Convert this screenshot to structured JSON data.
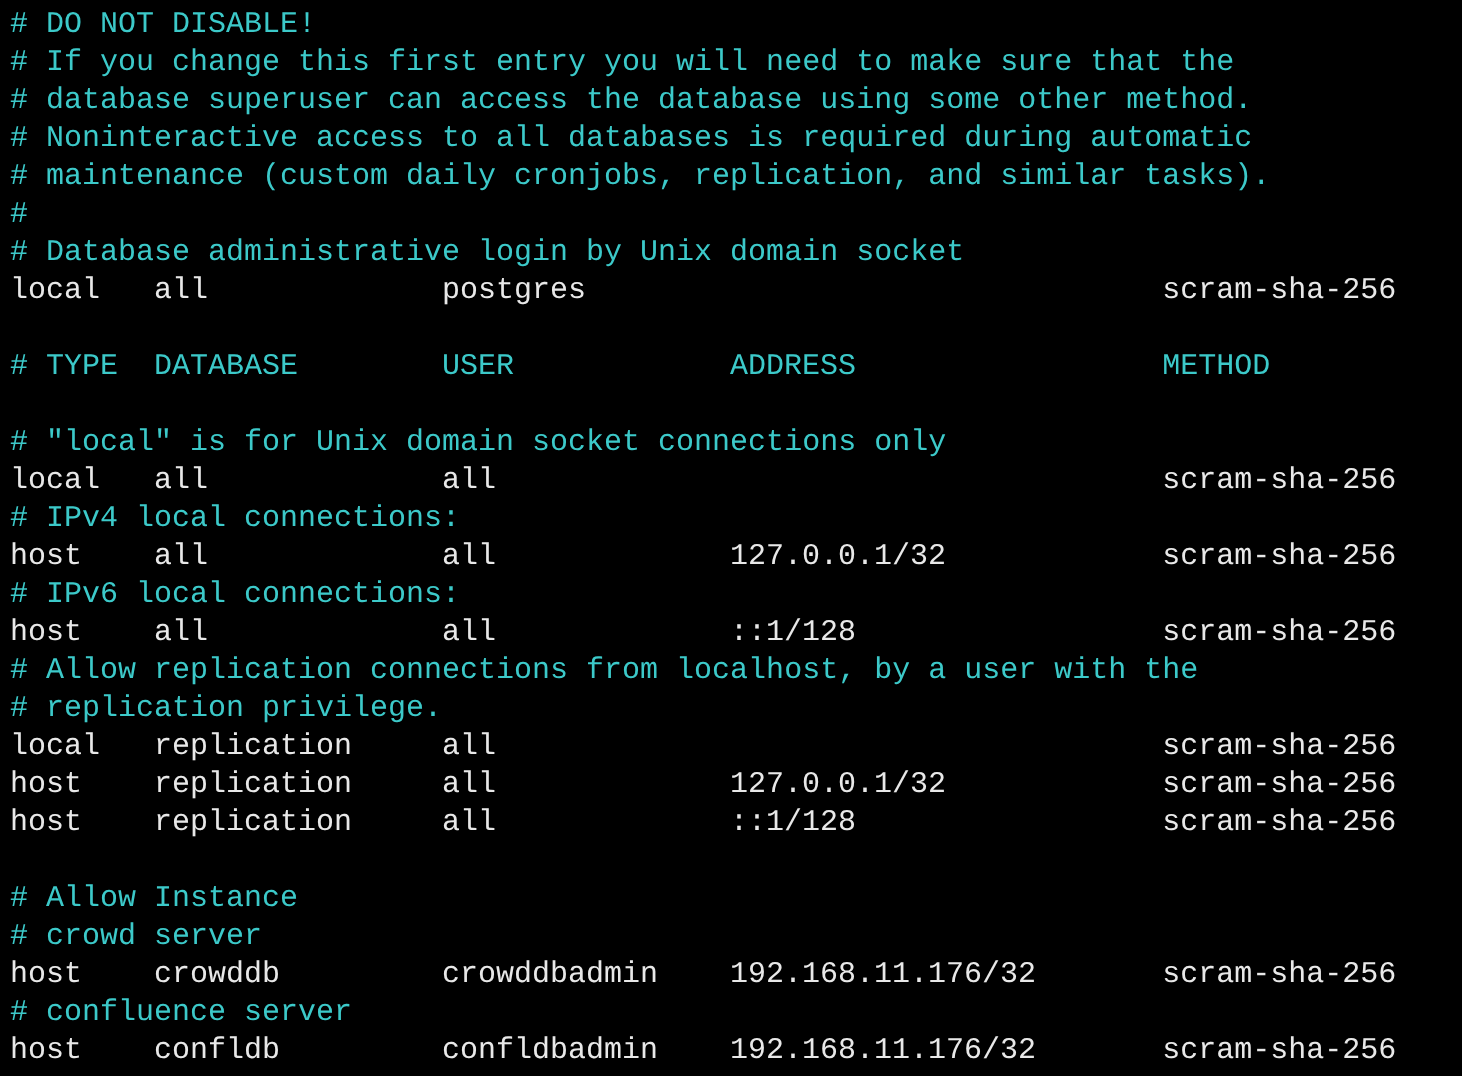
{
  "lines": [
    {
      "kind": "comment",
      "text": "# DO NOT DISABLE!"
    },
    {
      "kind": "comment",
      "text": "# If you change this first entry you will need to make sure that the"
    },
    {
      "kind": "comment",
      "text": "# database superuser can access the database using some other method."
    },
    {
      "kind": "comment",
      "text": "# Noninteractive access to all databases is required during automatic"
    },
    {
      "kind": "comment",
      "text": "# maintenance (custom daily cronjobs, replication, and similar tasks)."
    },
    {
      "kind": "comment",
      "text": "#"
    },
    {
      "kind": "comment",
      "text": "# Database administrative login by Unix domain socket"
    },
    {
      "kind": "entry",
      "type": "local",
      "database": "all",
      "user": "postgres",
      "method": "scram-sha-256"
    },
    {
      "kind": "blank"
    },
    {
      "kind": "header",
      "columns": [
        "# TYPE",
        "DATABASE",
        "USER",
        "ADDRESS",
        "METHOD"
      ]
    },
    {
      "kind": "blank"
    },
    {
      "kind": "comment",
      "text": "# \"local\" is for Unix domain socket connections only"
    },
    {
      "kind": "entry",
      "type": "local",
      "database": "all",
      "user": "all",
      "method": "scram-sha-256"
    },
    {
      "kind": "comment",
      "text": "# IPv4 local connections:"
    },
    {
      "kind": "entry",
      "type": "host",
      "database": "all",
      "user": "all",
      "address": "127.0.0.1/32",
      "method": "scram-sha-256"
    },
    {
      "kind": "comment",
      "text": "# IPv6 local connections:"
    },
    {
      "kind": "entry",
      "type": "host",
      "database": "all",
      "user": "all",
      "address": "::1/128",
      "method": "scram-sha-256"
    },
    {
      "kind": "comment",
      "text": "# Allow replication connections from localhost, by a user with the"
    },
    {
      "kind": "comment",
      "text": "# replication privilege."
    },
    {
      "kind": "entry",
      "type": "local",
      "database": "replication",
      "user": "all",
      "method": "scram-sha-256"
    },
    {
      "kind": "entry",
      "type": "host",
      "database": "replication",
      "user": "all",
      "address": "127.0.0.1/32",
      "method": "scram-sha-256"
    },
    {
      "kind": "entry",
      "type": "host",
      "database": "replication",
      "user": "all",
      "address": "::1/128",
      "method": "scram-sha-256"
    },
    {
      "kind": "blank"
    },
    {
      "kind": "comment",
      "text": "# Allow Instance"
    },
    {
      "kind": "comment",
      "text": "# crowd server"
    },
    {
      "kind": "entry",
      "type": "host",
      "database": "crowddb",
      "user": "crowddbadmin",
      "address": "192.168.11.176/32",
      "method": "scram-sha-256"
    },
    {
      "kind": "comment",
      "text": "# confluence server"
    },
    {
      "kind": "entry",
      "type": "host",
      "database": "confldb",
      "user": "confldbadmin",
      "address": "192.168.11.176/32",
      "method": "scram-sha-256"
    }
  ]
}
